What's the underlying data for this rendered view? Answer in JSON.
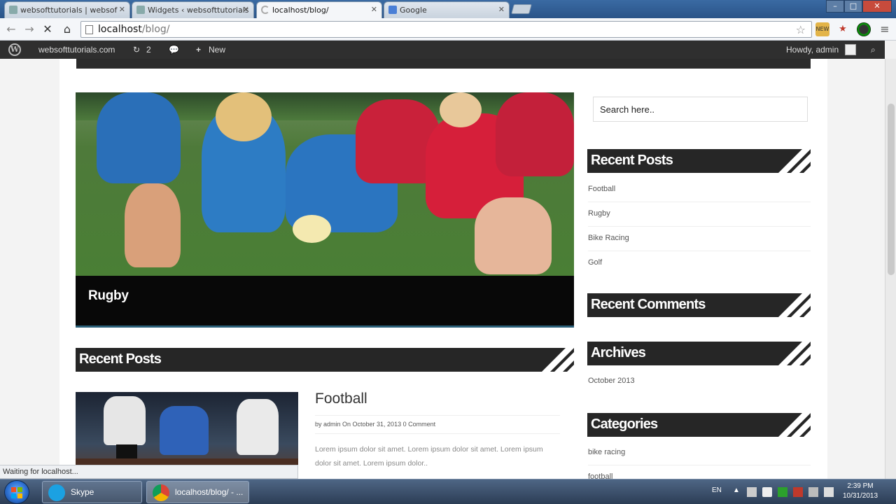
{
  "browser": {
    "tabs": [
      {
        "title": "websofttutorials | websof"
      },
      {
        "title": "Widgets ‹ websofttutorials"
      },
      {
        "title": "localhost/blog/"
      },
      {
        "title": "Google"
      }
    ],
    "address": {
      "host": "localhost",
      "path": "/blog/"
    },
    "status_text": "Waiting for localhost..."
  },
  "adminbar": {
    "site": "websofttutorials.com",
    "updates": "2",
    "new_label": "New",
    "greeting": "Howdy, admin"
  },
  "slider": {
    "caption": "Rugby"
  },
  "main": {
    "recent_posts_heading": "Recent Posts",
    "post": {
      "title": "Football",
      "meta": "by admin On October 31, 2013 0 Comment",
      "excerpt": "Lorem ipsum dolor sit amet. Lorem ipsum dolor sit amet. Lorem ipsum dolor sit amet. Lorem ipsum dolor.."
    }
  },
  "sidebar": {
    "search_placeholder": "Search here..",
    "recent_posts_heading": "Recent Posts",
    "recent_posts": [
      "Football",
      "Rugby",
      "Bike Racing",
      "Golf"
    ],
    "recent_comments_heading": "Recent Comments",
    "archives_heading": "Archives",
    "archives": [
      "October 2013"
    ],
    "categories_heading": "Categories",
    "categories": [
      "bike racing",
      "football"
    ]
  },
  "taskbar": {
    "tasks": [
      {
        "label": "Skype"
      },
      {
        "label": "localhost/blog/ - ..."
      }
    ],
    "language": "EN",
    "time": "2:39 PM",
    "date": "10/31/2013"
  },
  "colors": {
    "heading_bg": "#262626",
    "admin_bar": "#2f2f2f",
    "caption_bg": "#080808"
  }
}
